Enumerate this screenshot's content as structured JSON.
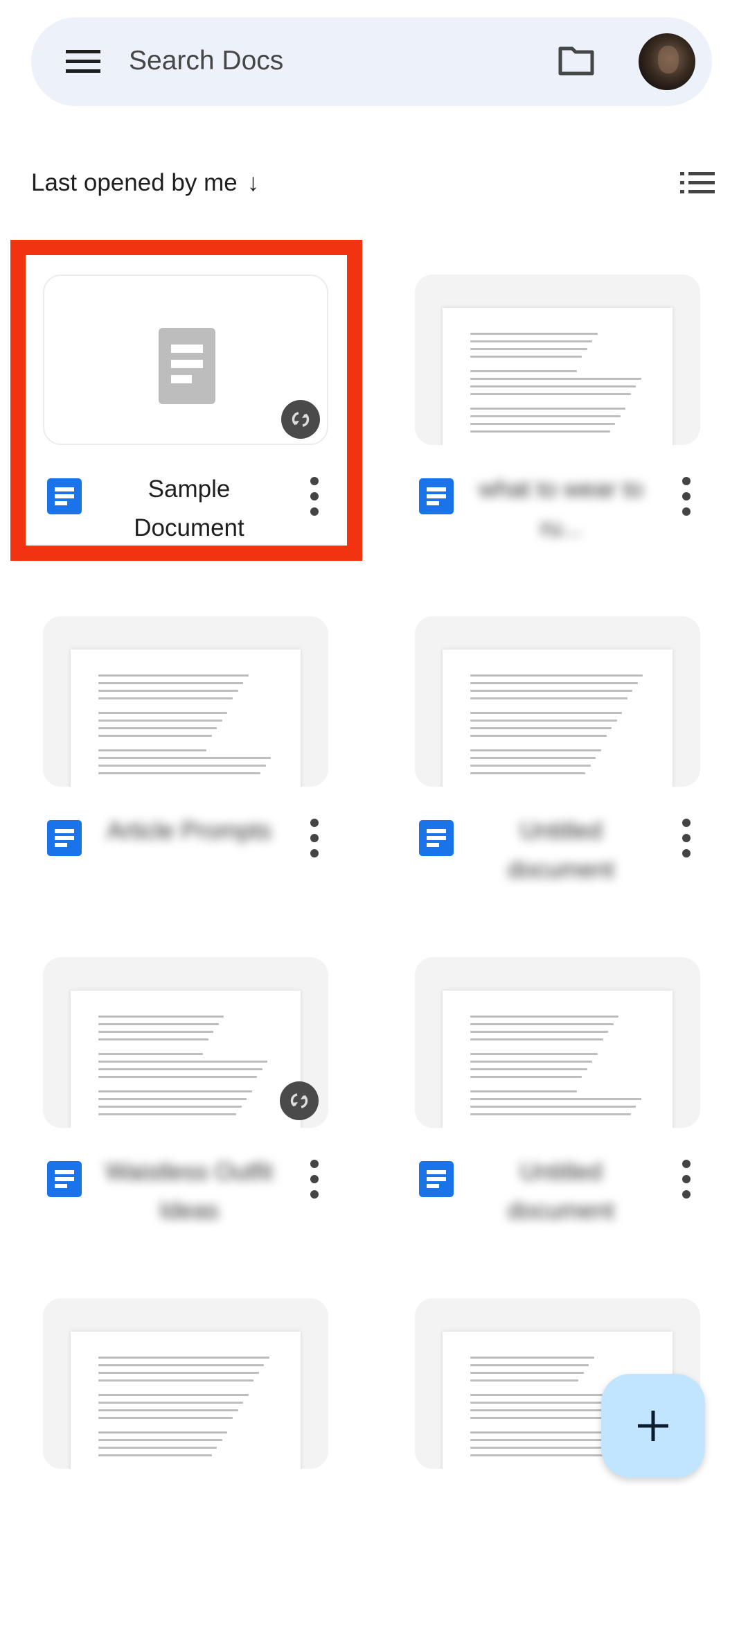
{
  "search": {
    "placeholder": "Search Docs"
  },
  "sort": {
    "label": "Last opened by me",
    "arrow": "↓"
  },
  "colors": {
    "accent": "#1a73e8",
    "highlight": "#f2330f",
    "fab": "#c2e5ff",
    "search_bg": "#edf1f9"
  },
  "icons": {
    "menu": "hamburger-icon",
    "folder": "folder-icon",
    "view": "list-view-icon",
    "doc": "docs-icon",
    "more": "more-vert-icon",
    "sync": "sync-icon",
    "add": "plus-icon"
  },
  "documents": [
    {
      "title": "Sample Document",
      "synced": true,
      "highlighted": true
    },
    {
      "title": "what to wear to ru...",
      "synced": false
    },
    {
      "title": "Article Prompts",
      "synced": false
    },
    {
      "title": "Untitled document",
      "synced": false
    },
    {
      "title": "Waistless Outfit Ideas",
      "synced": true
    },
    {
      "title": "Untitled document",
      "synced": false
    },
    {
      "title": "",
      "synced": false
    },
    {
      "title": "",
      "synced": false
    }
  ]
}
